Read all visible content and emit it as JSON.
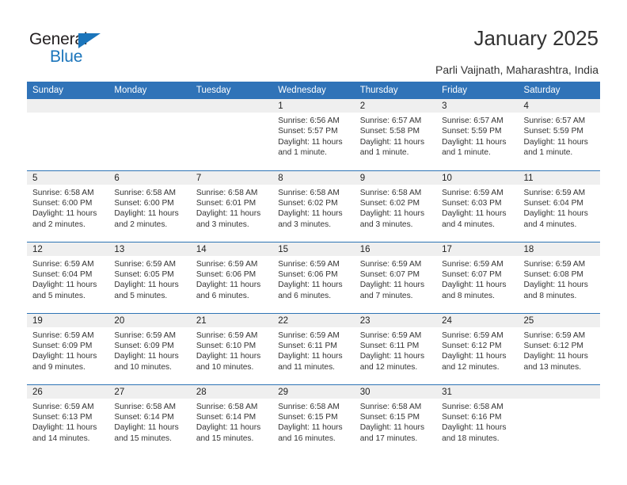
{
  "brand": {
    "name_part1": "General",
    "name_part2": "Blue",
    "accent_color": "#1b75bb"
  },
  "header": {
    "title": "January 2025",
    "subtitle": "Parli Vaijnath, Maharashtra, India"
  },
  "theme": {
    "header_blue": "#3073b8",
    "rule_blue": "#2e74b5",
    "daynum_bg": "#efefef"
  },
  "calendar": {
    "weekdays": [
      "Sunday",
      "Monday",
      "Tuesday",
      "Wednesday",
      "Thursday",
      "Friday",
      "Saturday"
    ],
    "labels": {
      "sunrise": "Sunrise:",
      "sunset": "Sunset:",
      "daylight": "Daylight:"
    },
    "weeks": [
      [
        {
          "day": "",
          "empty": true
        },
        {
          "day": "",
          "empty": true
        },
        {
          "day": "",
          "empty": true
        },
        {
          "day": "1",
          "sunrise": "Sunrise: 6:56 AM",
          "sunset": "Sunset: 5:57 PM",
          "daylight1": "Daylight: 11 hours",
          "daylight2": "and 1 minute."
        },
        {
          "day": "2",
          "sunrise": "Sunrise: 6:57 AM",
          "sunset": "Sunset: 5:58 PM",
          "daylight1": "Daylight: 11 hours",
          "daylight2": "and 1 minute."
        },
        {
          "day": "3",
          "sunrise": "Sunrise: 6:57 AM",
          "sunset": "Sunset: 5:59 PM",
          "daylight1": "Daylight: 11 hours",
          "daylight2": "and 1 minute."
        },
        {
          "day": "4",
          "sunrise": "Sunrise: 6:57 AM",
          "sunset": "Sunset: 5:59 PM",
          "daylight1": "Daylight: 11 hours",
          "daylight2": "and 1 minute."
        }
      ],
      [
        {
          "day": "5",
          "sunrise": "Sunrise: 6:58 AM",
          "sunset": "Sunset: 6:00 PM",
          "daylight1": "Daylight: 11 hours",
          "daylight2": "and 2 minutes."
        },
        {
          "day": "6",
          "sunrise": "Sunrise: 6:58 AM",
          "sunset": "Sunset: 6:00 PM",
          "daylight1": "Daylight: 11 hours",
          "daylight2": "and 2 minutes."
        },
        {
          "day": "7",
          "sunrise": "Sunrise: 6:58 AM",
          "sunset": "Sunset: 6:01 PM",
          "daylight1": "Daylight: 11 hours",
          "daylight2": "and 3 minutes."
        },
        {
          "day": "8",
          "sunrise": "Sunrise: 6:58 AM",
          "sunset": "Sunset: 6:02 PM",
          "daylight1": "Daylight: 11 hours",
          "daylight2": "and 3 minutes."
        },
        {
          "day": "9",
          "sunrise": "Sunrise: 6:58 AM",
          "sunset": "Sunset: 6:02 PM",
          "daylight1": "Daylight: 11 hours",
          "daylight2": "and 3 minutes."
        },
        {
          "day": "10",
          "sunrise": "Sunrise: 6:59 AM",
          "sunset": "Sunset: 6:03 PM",
          "daylight1": "Daylight: 11 hours",
          "daylight2": "and 4 minutes."
        },
        {
          "day": "11",
          "sunrise": "Sunrise: 6:59 AM",
          "sunset": "Sunset: 6:04 PM",
          "daylight1": "Daylight: 11 hours",
          "daylight2": "and 4 minutes."
        }
      ],
      [
        {
          "day": "12",
          "sunrise": "Sunrise: 6:59 AM",
          "sunset": "Sunset: 6:04 PM",
          "daylight1": "Daylight: 11 hours",
          "daylight2": "and 5 minutes."
        },
        {
          "day": "13",
          "sunrise": "Sunrise: 6:59 AM",
          "sunset": "Sunset: 6:05 PM",
          "daylight1": "Daylight: 11 hours",
          "daylight2": "and 5 minutes."
        },
        {
          "day": "14",
          "sunrise": "Sunrise: 6:59 AM",
          "sunset": "Sunset: 6:06 PM",
          "daylight1": "Daylight: 11 hours",
          "daylight2": "and 6 minutes."
        },
        {
          "day": "15",
          "sunrise": "Sunrise: 6:59 AM",
          "sunset": "Sunset: 6:06 PM",
          "daylight1": "Daylight: 11 hours",
          "daylight2": "and 6 minutes."
        },
        {
          "day": "16",
          "sunrise": "Sunrise: 6:59 AM",
          "sunset": "Sunset: 6:07 PM",
          "daylight1": "Daylight: 11 hours",
          "daylight2": "and 7 minutes."
        },
        {
          "day": "17",
          "sunrise": "Sunrise: 6:59 AM",
          "sunset": "Sunset: 6:07 PM",
          "daylight1": "Daylight: 11 hours",
          "daylight2": "and 8 minutes."
        },
        {
          "day": "18",
          "sunrise": "Sunrise: 6:59 AM",
          "sunset": "Sunset: 6:08 PM",
          "daylight1": "Daylight: 11 hours",
          "daylight2": "and 8 minutes."
        }
      ],
      [
        {
          "day": "19",
          "sunrise": "Sunrise: 6:59 AM",
          "sunset": "Sunset: 6:09 PM",
          "daylight1": "Daylight: 11 hours",
          "daylight2": "and 9 minutes."
        },
        {
          "day": "20",
          "sunrise": "Sunrise: 6:59 AM",
          "sunset": "Sunset: 6:09 PM",
          "daylight1": "Daylight: 11 hours",
          "daylight2": "and 10 minutes."
        },
        {
          "day": "21",
          "sunrise": "Sunrise: 6:59 AM",
          "sunset": "Sunset: 6:10 PM",
          "daylight1": "Daylight: 11 hours",
          "daylight2": "and 10 minutes."
        },
        {
          "day": "22",
          "sunrise": "Sunrise: 6:59 AM",
          "sunset": "Sunset: 6:11 PM",
          "daylight1": "Daylight: 11 hours",
          "daylight2": "and 11 minutes."
        },
        {
          "day": "23",
          "sunrise": "Sunrise: 6:59 AM",
          "sunset": "Sunset: 6:11 PM",
          "daylight1": "Daylight: 11 hours",
          "daylight2": "and 12 minutes."
        },
        {
          "day": "24",
          "sunrise": "Sunrise: 6:59 AM",
          "sunset": "Sunset: 6:12 PM",
          "daylight1": "Daylight: 11 hours",
          "daylight2": "and 12 minutes."
        },
        {
          "day": "25",
          "sunrise": "Sunrise: 6:59 AM",
          "sunset": "Sunset: 6:12 PM",
          "daylight1": "Daylight: 11 hours",
          "daylight2": "and 13 minutes."
        }
      ],
      [
        {
          "day": "26",
          "sunrise": "Sunrise: 6:59 AM",
          "sunset": "Sunset: 6:13 PM",
          "daylight1": "Daylight: 11 hours",
          "daylight2": "and 14 minutes."
        },
        {
          "day": "27",
          "sunrise": "Sunrise: 6:58 AM",
          "sunset": "Sunset: 6:14 PM",
          "daylight1": "Daylight: 11 hours",
          "daylight2": "and 15 minutes."
        },
        {
          "day": "28",
          "sunrise": "Sunrise: 6:58 AM",
          "sunset": "Sunset: 6:14 PM",
          "daylight1": "Daylight: 11 hours",
          "daylight2": "and 15 minutes."
        },
        {
          "day": "29",
          "sunrise": "Sunrise: 6:58 AM",
          "sunset": "Sunset: 6:15 PM",
          "daylight1": "Daylight: 11 hours",
          "daylight2": "and 16 minutes."
        },
        {
          "day": "30",
          "sunrise": "Sunrise: 6:58 AM",
          "sunset": "Sunset: 6:15 PM",
          "daylight1": "Daylight: 11 hours",
          "daylight2": "and 17 minutes."
        },
        {
          "day": "31",
          "sunrise": "Sunrise: 6:58 AM",
          "sunset": "Sunset: 6:16 PM",
          "daylight1": "Daylight: 11 hours",
          "daylight2": "and 18 minutes."
        },
        {
          "day": "",
          "empty": true
        }
      ]
    ]
  }
}
